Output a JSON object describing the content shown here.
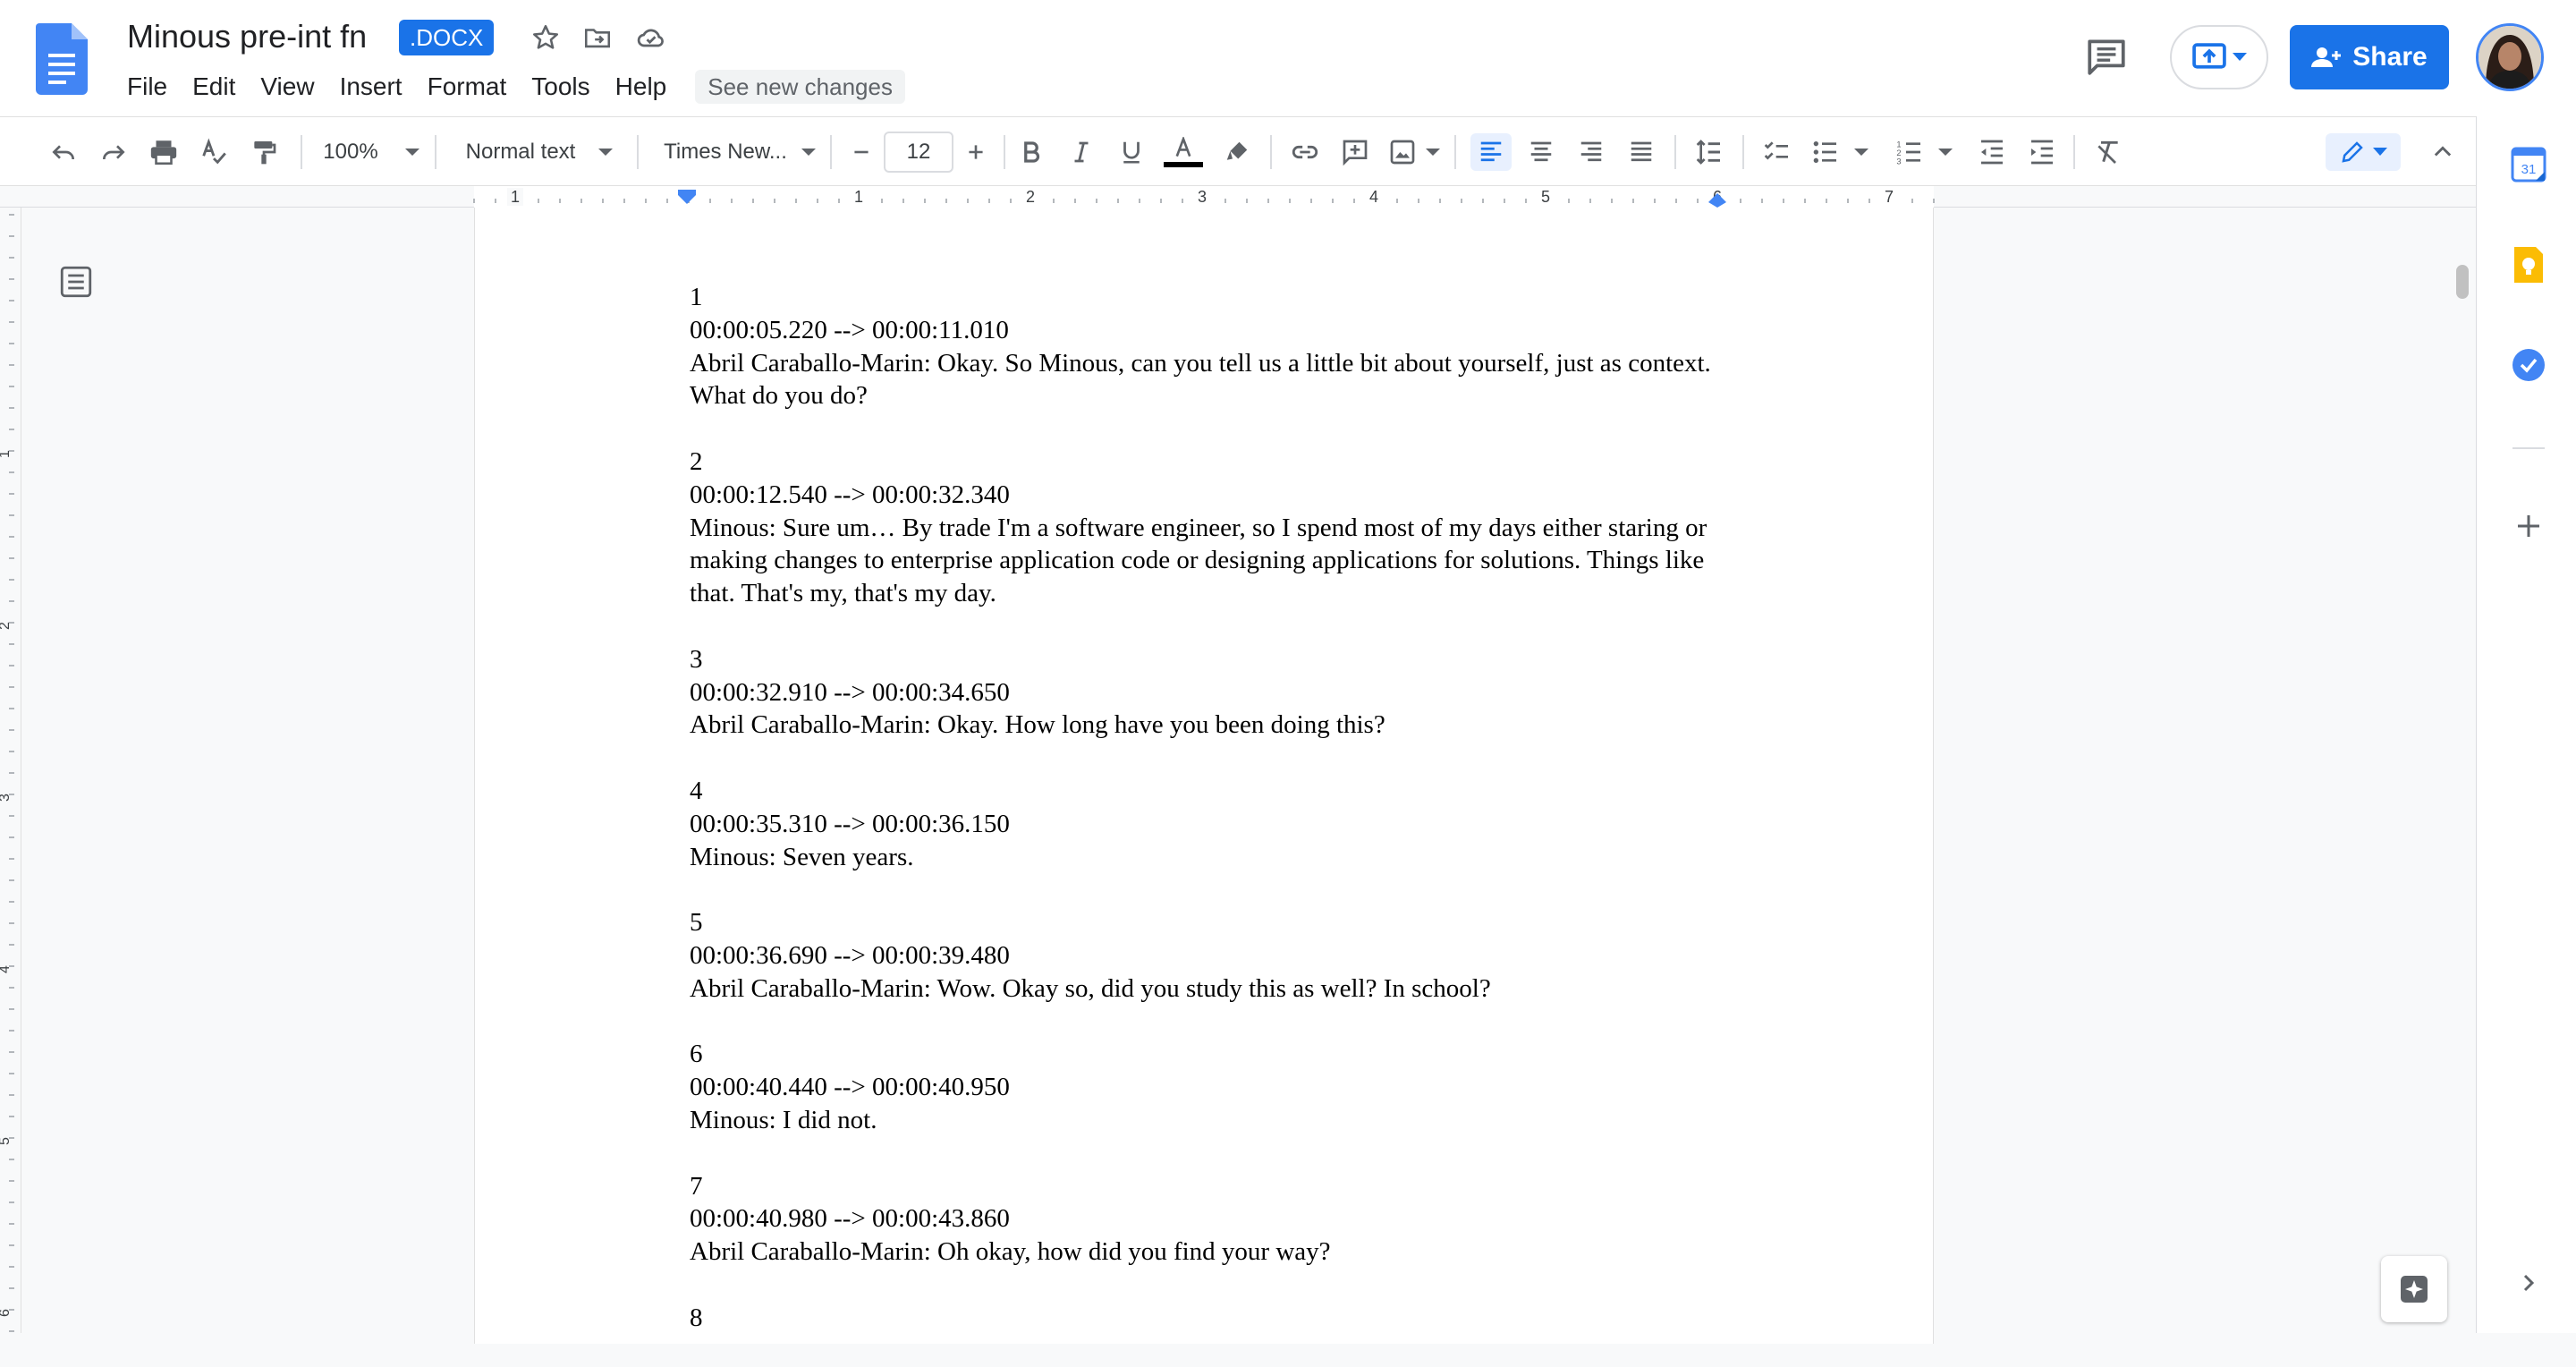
{
  "title_bar": {
    "doc_title": "Minous pre-int fn",
    "file_badge": ".DOCX",
    "share_label": "Share",
    "icons": [
      "docs-logo-icon",
      "star-icon",
      "move-folder-icon",
      "cloud-status-icon",
      "comment-icon",
      "present-icon",
      "person-icon",
      "avatar"
    ]
  },
  "menu": {
    "items": [
      "File",
      "Edit",
      "View",
      "Insert",
      "Format",
      "Tools",
      "Help"
    ],
    "see_changes": "See new changes"
  },
  "toolbar": {
    "zoom": "100%",
    "style": "Normal text",
    "font": "Times New...",
    "font_size": "12",
    "icons": [
      "undo-icon",
      "redo-icon",
      "print-icon",
      "spellcheck-icon",
      "paint-format-icon",
      "bold-icon",
      "italic-icon",
      "underline-icon",
      "text-color-icon",
      "highlight-icon",
      "link-icon",
      "add-comment-icon",
      "image-icon",
      "align-left-icon",
      "align-center-icon",
      "align-right-icon",
      "justify-icon",
      "line-spacing-icon",
      "checklist-icon",
      "bulleted-list-icon",
      "numbered-list-icon",
      "decrease-indent-icon",
      "increase-indent-icon",
      "clear-formatting-icon",
      "editing-mode-icon",
      "collapse-icon"
    ]
  },
  "ruler": {
    "h_labels": [
      "1",
      "1",
      "2",
      "3",
      "4",
      "5",
      "6",
      "7"
    ],
    "v_labels": [
      "1",
      "2",
      "3",
      "4",
      "5",
      "6"
    ]
  },
  "document": {
    "entries": [
      {
        "num": "1",
        "time": "00:00:05.220 --> 00:00:11.010",
        "text": "Abril Caraballo-Marin: Okay. So Minous, can you tell us a little bit about yourself, just as context. What do you do?"
      },
      {
        "num": "2",
        "time": "00:00:12.540 --> 00:00:32.340",
        "text": "Minous: Sure um… By trade I'm a software engineer, so I spend most of my days either staring or making changes to enterprise application code or designing applications for solutions. Things like that. That's my, that's my day."
      },
      {
        "num": "3",
        "time": "00:00:32.910 --> 00:00:34.650",
        "text": "Abril Caraballo-Marin: Okay. How long have you been doing this?"
      },
      {
        "num": "4",
        "time": "00:00:35.310 --> 00:00:36.150",
        "text": "Minous: Seven years."
      },
      {
        "num": "5",
        "time": "00:00:36.690 --> 00:00:39.480",
        "text": "Abril Caraballo-Marin: Wow. Okay so, did you study this as well? In school?"
      },
      {
        "num": "6",
        "time": "00:00:40.440 --> 00:00:40.950",
        "text": "Minous: I did not."
      },
      {
        "num": "7",
        "time": "00:00:40.980 --> 00:00:43.860",
        "text": "Abril Caraballo-Marin: Oh okay, how did you find your way?"
      },
      {
        "num": "8",
        "time": "",
        "text": ""
      }
    ]
  },
  "side_panel": {
    "icons": [
      "calendar-icon",
      "keep-icon",
      "tasks-icon",
      "add-icon",
      "expand-panel-icon"
    ],
    "calendar_day": "31"
  },
  "colors": {
    "accent": "#1a73e8",
    "docs_blue": "#4285f4",
    "keep_yellow": "#fbbc04"
  }
}
